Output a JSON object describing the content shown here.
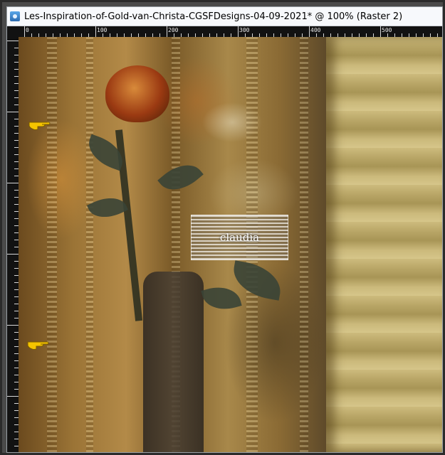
{
  "window": {
    "title": "Les-Inspiration-of-Gold-van-Christa-CGSFDesigns-04-09-2021* @ 100% (Raster 2)",
    "icon": "paintshop-pro-document-icon"
  },
  "ruler": {
    "top_labels": [
      "0",
      "100",
      "200",
      "300",
      "400",
      "500"
    ]
  },
  "canvas": {
    "watermark_text": "claudia",
    "pointer_icon": "pointing-hand-icon"
  }
}
